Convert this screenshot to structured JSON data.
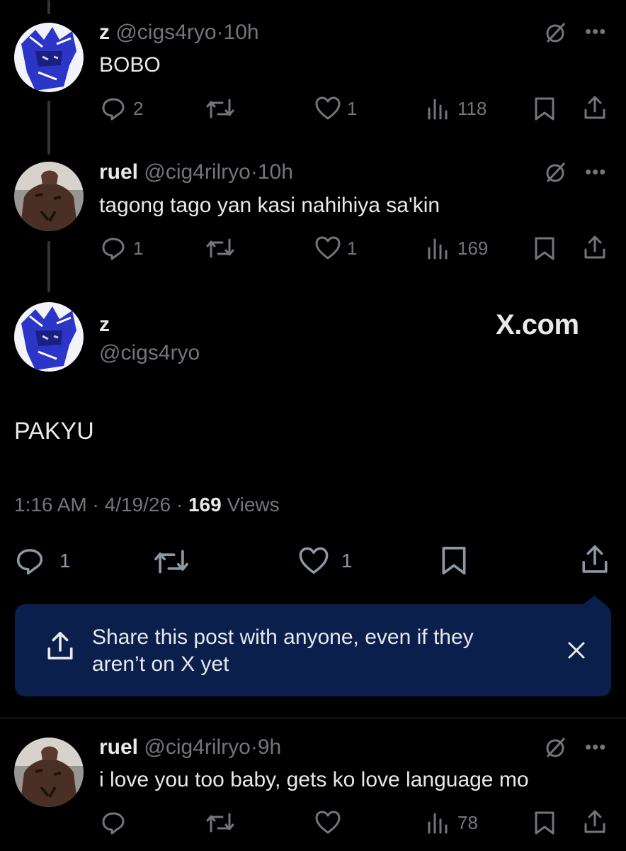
{
  "replies": [
    {
      "name": "z",
      "handle": "@cigs4ryo",
      "time": "10h",
      "text": "BOBO",
      "replies_count": "2",
      "likes_count": "1",
      "views_count": "118"
    },
    {
      "name": "ruel",
      "handle": "@cig4rilryo",
      "time": "10h",
      "text": "tagong tago yan kasi nahihiya sa'kin",
      "replies_count": "1",
      "likes_count": "1",
      "views_count": "169"
    }
  ],
  "main_post": {
    "name": "z",
    "handle": "@cigs4ryo",
    "text": "PAKYU",
    "time": "1:16 AM",
    "date": "4/19/26",
    "views": "169",
    "views_label": "Views",
    "replies_count": "1",
    "likes_count": "1",
    "watermark": "X.com"
  },
  "share_tooltip": {
    "text_line1": "Share this post with anyone, even if they",
    "text_line2": "aren’t on X yet"
  },
  "last_reply": {
    "name": "ruel",
    "handle": "@cig4rilryo",
    "time": "9h",
    "text": "i love you too baby, gets ko love language mo",
    "views_count": "78"
  },
  "separator": "·",
  "colors": {
    "background": "#000000",
    "text": "#e7e9ea",
    "muted": "#71767b",
    "tooltip_bg": "#0b1f4d"
  },
  "icons": [
    "reply-icon",
    "repost-icon",
    "like-icon",
    "views-icon",
    "bookmark-icon",
    "share-icon",
    "grok-icon",
    "more-icon",
    "close-icon"
  ]
}
